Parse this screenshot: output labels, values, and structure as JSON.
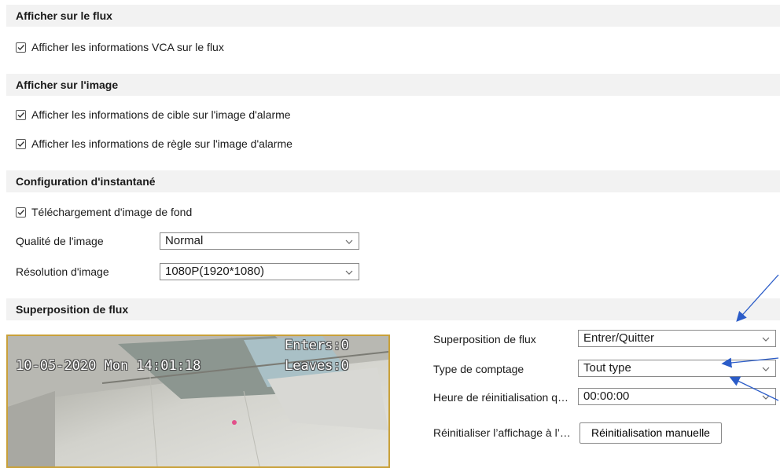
{
  "sections": {
    "stream": {
      "title": "Afficher sur le flux",
      "items": [
        {
          "label": "Afficher les informations VCA sur le flux",
          "checked": true
        }
      ]
    },
    "image": {
      "title": "Afficher sur l'image",
      "items": [
        {
          "label": "Afficher les informations de cible sur l'image d'alarme",
          "checked": true
        },
        {
          "label": "Afficher les informations de règle sur l'image d'alarme",
          "checked": true
        }
      ]
    },
    "snapshot": {
      "title": "Configuration d'instantané",
      "items": [
        {
          "label": "Téléchargement d'image de fond",
          "checked": true
        }
      ],
      "quality_label": "Qualité de l'image",
      "quality_value": "Normal",
      "resolution_label": "Résolution d'image",
      "resolution_value": "1080P(1920*1080)"
    },
    "overlay": {
      "title": "Superposition de flux",
      "fields": [
        {
          "label": "Superposition de flux",
          "value": "Entrer/Quitter"
        },
        {
          "label": "Type de comptage",
          "value": "Tout type"
        },
        {
          "label": "Heure de réinitialisation q…",
          "value": "00:00:00"
        }
      ],
      "reset_label": "Réinitialiser l’affichage à l’…",
      "reset_button": "Réinitialisation manuelle"
    }
  },
  "video": {
    "timestamp": "10-05-2020 Mon 14:01:18",
    "enters": "Enters:0",
    "leaves": "Leaves:0"
  },
  "colors": {
    "header_bg": "#f2f2f2",
    "annotation_arrow": "#2b5cc8",
    "video_border": "#c9a13a"
  }
}
